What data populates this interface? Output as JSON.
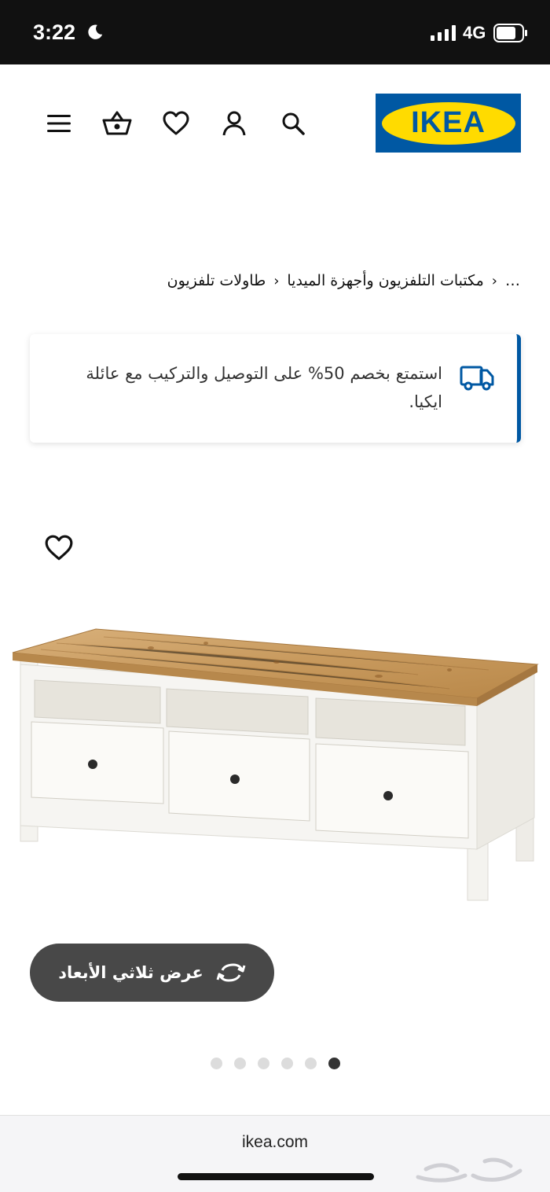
{
  "status_bar": {
    "time": "3:22",
    "network": "4G"
  },
  "header": {
    "logo_text": "IKEA",
    "icons": [
      "menu-icon",
      "basket-icon",
      "heart-icon",
      "user-icon",
      "search-icon"
    ]
  },
  "breadcrumb": {
    "items": [
      "…",
      "مكتبات التلفزيون وأجهزة الميديا",
      "طاولات تلفزيون"
    ]
  },
  "promo": {
    "text": "استمتع بخصم 50% على التوصيل والتركيب مع عائلة ايكيا.",
    "icon": "truck-icon"
  },
  "product": {
    "view_3d_label": "عرض ثلاثي الأبعاد",
    "carousel_dots": 6,
    "active_dot": 6
  },
  "browser": {
    "url": "ikea.com"
  },
  "colors": {
    "brand_blue": "#0058a3",
    "brand_yellow": "#ffdb00",
    "button_dark": "#484848"
  }
}
